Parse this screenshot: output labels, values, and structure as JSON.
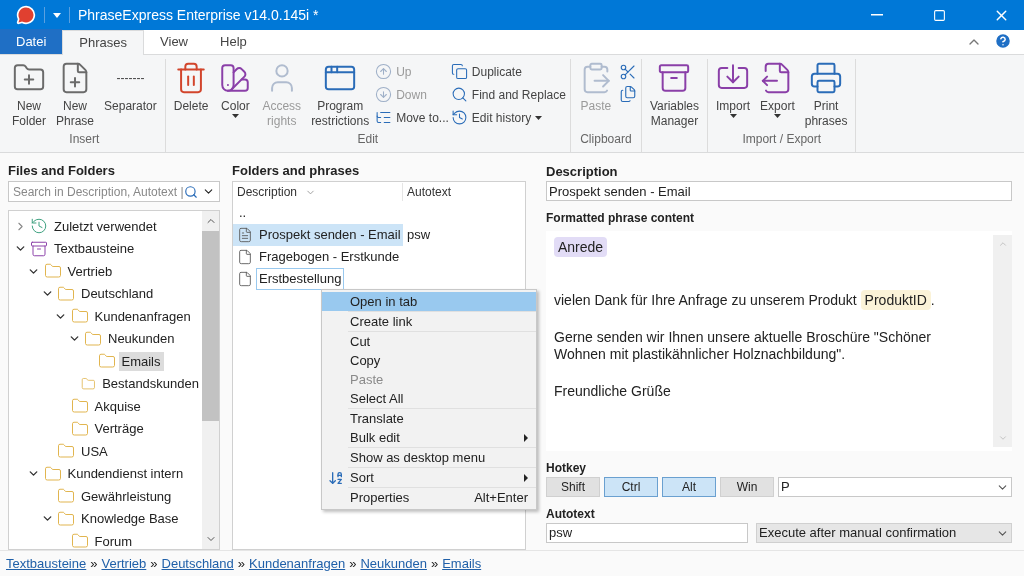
{
  "window": {
    "title": "PhraseExpress Enterprise v14.0.145i *"
  },
  "ribbon_tabs": [
    {
      "label": "Datei",
      "kind": "file",
      "selected": false
    },
    {
      "label": "Phrases",
      "kind": "tab",
      "selected": true
    },
    {
      "label": "View",
      "kind": "tab",
      "selected": false
    },
    {
      "label": "Help",
      "kind": "tab",
      "selected": false
    }
  ],
  "ribbon": {
    "groups": [
      {
        "label": "Insert",
        "items": [
          {
            "kind": "large",
            "label": "New Folder"
          },
          {
            "kind": "large",
            "label": "New Phrase"
          },
          {
            "kind": "glyph",
            "glyph": "-------",
            "label": "Separator"
          }
        ]
      },
      {
        "label": "Edit",
        "items": [
          {
            "kind": "large",
            "label": "Delete"
          },
          {
            "kind": "large",
            "label": "Color",
            "dropdown": true
          },
          {
            "kind": "large",
            "label": "Access rights",
            "disabled": true
          },
          {
            "kind": "large",
            "label": "Program restrictions"
          },
          {
            "kind": "column",
            "children": [
              {
                "label": "Up",
                "disabled": true
              },
              {
                "label": "Down",
                "disabled": true
              },
              {
                "label": "Move to..."
              }
            ]
          },
          {
            "kind": "column",
            "children": [
              {
                "label": "Duplicate"
              },
              {
                "label": "Find and Replace"
              },
              {
                "label": "Edit history",
                "dropdown": true
              }
            ]
          }
        ]
      },
      {
        "label": "Clipboard",
        "items": [
          {
            "kind": "large",
            "label": "Paste",
            "disabled": true
          },
          {
            "kind": "icons"
          }
        ]
      },
      {
        "items": [
          {
            "kind": "large",
            "label": "Variables Manager"
          }
        ]
      },
      {
        "label": "Import / Export",
        "items": [
          {
            "kind": "large",
            "label": "Import",
            "dropdown": true
          },
          {
            "kind": "large",
            "label": "Export",
            "dropdown": true
          },
          {
            "kind": "large",
            "label": "Print phrases"
          }
        ]
      }
    ]
  },
  "tree": {
    "title": "Files and Folders",
    "search_placeholder": "Search in Description, Autotext |",
    "items": [
      {
        "label": "Zuletzt verwendet",
        "kind": "recent",
        "expanded": false,
        "selected": false
      },
      {
        "label": "Textbausteine",
        "kind": "library",
        "expanded": true,
        "selected": false,
        "children": [
          {
            "label": "Vertrieb",
            "kind": "folder",
            "expanded": true,
            "selected": false,
            "children": [
              {
                "label": "Deutschland",
                "kind": "folder",
                "expanded": true,
                "selected": false,
                "children": [
                  {
                    "label": "Kundenanfragen",
                    "kind": "folder",
                    "expanded": true,
                    "selected": false,
                    "children": [
                      {
                        "label": "Neukunden",
                        "kind": "folder",
                        "expanded": true,
                        "selected": false,
                        "children": [
                          {
                            "label": "Emails",
                            "kind": "folder",
                            "selected": true
                          }
                        ]
                      },
                      {
                        "label": "Bestandskunden",
                        "kind": "folder",
                        "selected": false
                      }
                    ]
                  },
                  {
                    "label": "Akquise",
                    "kind": "folder",
                    "selected": false
                  },
                  {
                    "label": "Verträge",
                    "kind": "folder",
                    "selected": false
                  }
                ]
              },
              {
                "label": "USA",
                "kind": "folder",
                "selected": false
              }
            ]
          },
          {
            "label": "Kundendienst intern",
            "kind": "folder",
            "expanded": true,
            "selected": false,
            "children": [
              {
                "label": "Gewährleistung",
                "kind": "folder",
                "selected": false
              },
              {
                "label": "Knowledge Base",
                "kind": "folder",
                "expanded": true,
                "selected": false,
                "children": [
                  {
                    "label": "Forum",
                    "kind": "folder",
                    "selected": false
                  }
                ]
              }
            ]
          }
        ]
      }
    ]
  },
  "phrases": {
    "title": "Folders and phrases",
    "columns": [
      "Description",
      "Autotext"
    ],
    "rows": [
      {
        "kind": "parent",
        "description": "..",
        "selected": false,
        "focused": false
      },
      {
        "kind": "formatted",
        "description": "Prospekt senden - Email",
        "autotext": "psw",
        "selected": true,
        "focused": false
      },
      {
        "kind": "plain",
        "description": "Fragebogen - Erstkunde",
        "selected": false,
        "focused": false
      },
      {
        "kind": "plain",
        "description": "Erstbestellung",
        "selected": false,
        "focused": true
      }
    ]
  },
  "context_menu": {
    "groups": [
      [
        {
          "label": "Open in tab",
          "selected": true
        }
      ],
      [
        {
          "label": "Create link",
          "selected": false
        }
      ],
      [
        {
          "label": "Cut",
          "selected": false
        },
        {
          "label": "Copy",
          "selected": false
        },
        {
          "label": "Paste",
          "selected": false,
          "disabled": true
        },
        {
          "label": "Select All",
          "selected": false
        }
      ],
      [
        {
          "label": "Translate",
          "selected": false
        },
        {
          "label": "Bulk edit",
          "selected": false,
          "submenu": true
        }
      ],
      [
        {
          "label": "Show as desktop menu",
          "selected": false
        }
      ],
      [
        {
          "label": "Sort",
          "selected": false,
          "submenu": true
        }
      ],
      [
        {
          "label": "Properties",
          "selected": false,
          "shortcut": "Alt+Enter"
        }
      ]
    ]
  },
  "details": {
    "description_label": "Description",
    "description": "Prospekt senden - Email",
    "content_label": "Formatted phrase content",
    "content": [
      [
        {
          "kind": "variable",
          "text": "Anrede",
          "color": "#e2dcf6"
        }
      ],
      [
        {
          "kind": "text",
          "text": "vielen Dank für Ihre Anfrage zu unserem Produkt "
        },
        {
          "kind": "variable",
          "text": "ProduktID",
          "color": "#fbf3d8"
        },
        {
          "kind": "text",
          "text": "."
        }
      ],
      [
        {
          "kind": "text",
          "text": "Gerne senden wir Ihnen unsere aktuelle Broschüre \"Schöner Wohnen mit plastikähnlicher Holznachbildung\"."
        }
      ],
      [
        {
          "kind": "text",
          "text": "Freundliche Grüße"
        }
      ]
    ],
    "hotkey_label": "Hotkey",
    "modifiers": [
      {
        "label": "Shift",
        "selected": false
      },
      {
        "label": "Ctrl",
        "selected": true
      },
      {
        "label": "Alt",
        "selected": true
      },
      {
        "label": "Win",
        "selected": false
      }
    ],
    "hotkey_key": "P",
    "autotext_label": "Autotext",
    "autotext": "psw",
    "autotext_mode": "Execute after manual confirmation"
  },
  "breadcrumb": [
    "Textbausteine",
    "Vertrieb",
    "Deutschland",
    "Kundenanfragen",
    "Neukunden",
    "Emails"
  ],
  "breadcrumb_separator": "»"
}
